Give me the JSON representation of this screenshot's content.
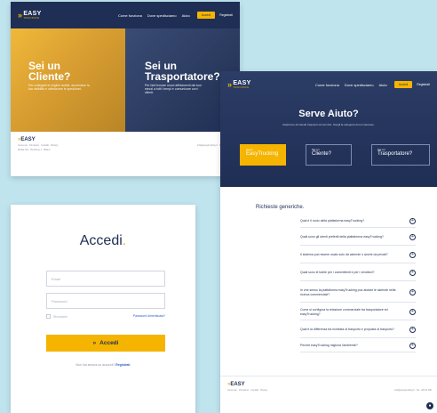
{
  "brand": {
    "name": "EASY",
    "sub": "TRUCKING",
    "chev": "»"
  },
  "nav": {
    "links": [
      "Come funziona",
      "Dove spedisciamo",
      "Aiuto"
    ],
    "login": "Accedi",
    "register": "Registrati"
  },
  "home": {
    "left_title": "Sei un Cliente?",
    "left_sub": "Per collegarti ai migliori autisti, aumentare la tua visibilità e ottimizzare le spedizioni.",
    "right_title": "Sei un Trasportatore?",
    "right_sub": "Per farti trovare nuovi affidamenti dai tuoi mezzi a tutti i tempi e comunicare con i clienti.",
    "footer_text": "Cerca qui · Chi siamo · Contatti · Privacy",
    "footer_meta": "Partita IVA · Via Roma 1 · Milano",
    "footer_right": "info@easytrucking.it · Tel. +39 02 000"
  },
  "help": {
    "title": "Serve Aiuto?",
    "subtitle": "Esplora le domande frequenti sul servizio. Scegli la categoria di tuo interesse.",
    "categories": [
      {
        "small": "Cos'è",
        "big": "EasyTrucking"
      },
      {
        "small": "Sei un",
        "big": "Cliente?"
      },
      {
        "small": "Sei un",
        "big": "Trasportatore?"
      }
    ],
    "faq_title": "Richieste generiche.",
    "faqs": [
      "Qual è il ruolo della piattaforma easyTrucking?",
      "Quali sono gli utenti preferiti della piattaforma easyTrucking?",
      "Il sistema può essere usato solo da aziende o anche da privati?",
      "Quali sono le tutele per i committenti e per i venditori?",
      "In che senso la piattaforma easyTrucking può aiutare le aziende nella ricerca commerciale?",
      "Come si configura la relazione commerciale tra trasportatore ed easyTrucking?",
      "Qual è la differenza tra richiesta di trasporto e proposta di trasporto?",
      "Perché easyTrucking migliora l'ambiente?"
    ],
    "footer_text": "Cerca qui · Chi siamo · Contatti · Privacy",
    "footer_right": "info@easytrucking.it · Tel. +39 02 000",
    "chat": "●"
  },
  "login": {
    "title": "Accedi",
    "dot": ".",
    "email_placeholder": "Email",
    "password_placeholder": "Password",
    "remember": "Ricordami",
    "forgot": "Password dimenticata?",
    "button": "Accedi",
    "button_icon": "»",
    "register_prompt": "Non hai ancora un account?",
    "register_link": "Registrati"
  },
  "colors": {
    "navy": "#1f2e54",
    "yellow": "#f5b400",
    "bg": "#bfe4ee"
  }
}
